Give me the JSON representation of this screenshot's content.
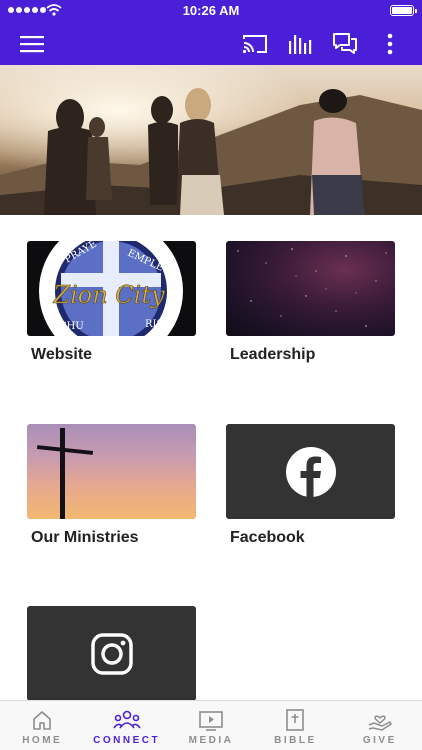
{
  "status_bar": {
    "time": "10:26 AM"
  },
  "header": {
    "icons": [
      "menu-icon",
      "cast-icon",
      "audio-bars-icon",
      "chat-icon",
      "more-vertical-icon"
    ]
  },
  "tiles": [
    {
      "label": "Website",
      "image_text": [
        "PRAYE",
        "EMPLE",
        "Zion City",
        "CHU",
        "RIST"
      ]
    },
    {
      "label": "Leadership"
    },
    {
      "label": "Our Ministries"
    },
    {
      "label": "Facebook",
      "icon": "facebook-icon"
    },
    {
      "label": "",
      "icon": "instagram-icon"
    }
  ],
  "tabs": [
    {
      "label": "HOME",
      "icon": "home-icon",
      "active": false
    },
    {
      "label": "CONNECT",
      "icon": "people-icon",
      "active": true
    },
    {
      "label": "MEDIA",
      "icon": "play-screen-icon",
      "active": false
    },
    {
      "label": "BIBLE",
      "icon": "bible-icon",
      "active": false
    },
    {
      "label": "GIVE",
      "icon": "giving-hand-icon",
      "active": false
    }
  ],
  "colors": {
    "primary": "#4b1fd8",
    "tab_inactive": "#8e8e8e",
    "tile_dark": "#333333"
  }
}
